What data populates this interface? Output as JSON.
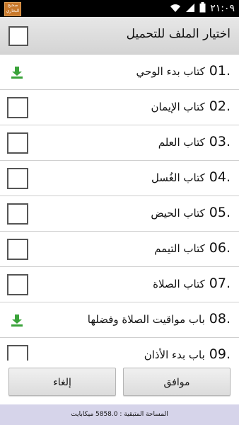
{
  "statusbar": {
    "time": "٢١:٠٩",
    "app_badge": "صحيح البخاري"
  },
  "header": {
    "title": "اختيار الملف للتحميل"
  },
  "items": [
    {
      "number": "01.",
      "title": "كتاب بدء الوحي",
      "state": "download"
    },
    {
      "number": "02.",
      "title": "كتاب الإيمان",
      "state": "checkbox"
    },
    {
      "number": "03.",
      "title": "كتاب العلم",
      "state": "checkbox"
    },
    {
      "number": "04.",
      "title": "كتاب الغُسل",
      "state": "checkbox"
    },
    {
      "number": "05.",
      "title": "كتاب الحيض",
      "state": "checkbox"
    },
    {
      "number": "06.",
      "title": "كتاب التيمم",
      "state": "checkbox"
    },
    {
      "number": "07.",
      "title": "كتاب الصلاة",
      "state": "checkbox"
    },
    {
      "number": "08.",
      "title": "باب مواقيت الصلاة وفضلها",
      "state": "download"
    },
    {
      "number": "09.",
      "title": "باب بدء الأذان",
      "state": "checkbox"
    }
  ],
  "buttons": {
    "ok_label": "موافق",
    "cancel_label": "إلغاء"
  },
  "storage_text": "المساحة المتبقية : 5858.0 ميكابايت",
  "colors": {
    "download_icon": "#3aa33a",
    "bottom_bar": "#d6d4ea"
  }
}
